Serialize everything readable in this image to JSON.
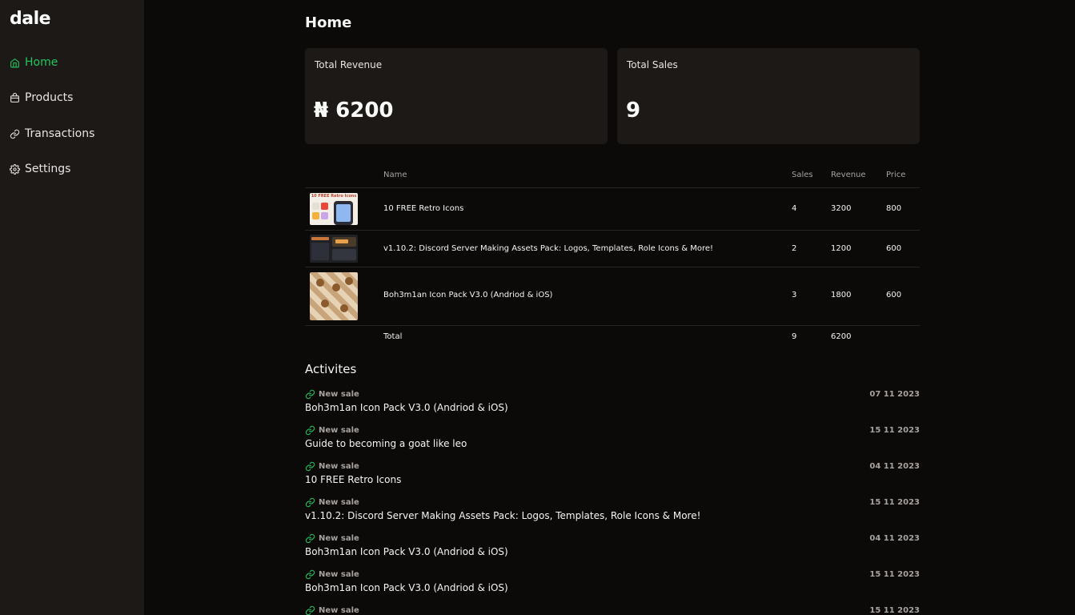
{
  "app": {
    "logo": "dale"
  },
  "sidebar": {
    "items": [
      {
        "label": "Home",
        "icon": "home-icon",
        "active": true
      },
      {
        "label": "Products",
        "icon": "bag-icon",
        "active": false
      },
      {
        "label": "Transactions",
        "icon": "link-icon",
        "active": false
      },
      {
        "label": "Settings",
        "icon": "gear-icon",
        "active": false
      }
    ]
  },
  "page": {
    "title": "Home"
  },
  "stats": {
    "revenue": {
      "label": "Total Revenue",
      "value": "₦ 6200"
    },
    "sales": {
      "label": "Total Sales",
      "value": "9"
    }
  },
  "table": {
    "headers": {
      "name": "Name",
      "sales": "Sales",
      "revenue": "Revenue",
      "price": "Price"
    },
    "rows": [
      {
        "name": "10 FREE Retro Icons",
        "sales": "4",
        "revenue": "3200",
        "price": "800",
        "thumb_text": "10 FREE Retro Icons"
      },
      {
        "name": "v1.10.2: Discord Server Making Assets Pack: Logos, Templates, Role Icons & More!",
        "sales": "2",
        "revenue": "1200",
        "price": "600"
      },
      {
        "name": "Boh3m1an Icon Pack V3.0 (Andriod & iOS)",
        "sales": "3",
        "revenue": "1800",
        "price": "600"
      }
    ],
    "total": {
      "label": "Total",
      "sales": "9",
      "revenue": "6200"
    }
  },
  "activities": {
    "title": "Activites",
    "items": [
      {
        "type": "New sale",
        "name": "Boh3m1an Icon Pack V3.0 (Andriod & iOS)",
        "date": "07 11 2023"
      },
      {
        "type": "New sale",
        "name": "Guide to becoming a goat like leo",
        "date": "15 11 2023"
      },
      {
        "type": "New sale",
        "name": "10 FREE Retro Icons",
        "date": "04 11 2023"
      },
      {
        "type": "New sale",
        "name": "v1.10.2: Discord Server Making Assets Pack: Logos, Templates, Role Icons & More!",
        "date": "15 11 2023"
      },
      {
        "type": "New sale",
        "name": "Boh3m1an Icon Pack V3.0 (Andriod & iOS)",
        "date": "04 11 2023"
      },
      {
        "type": "New sale",
        "name": "Boh3m1an Icon Pack V3.0 (Andriod & iOS)",
        "date": "15 11 2023"
      },
      {
        "type": "New sale",
        "name": "",
        "date": "15 11 2023"
      }
    ]
  },
  "colors": {
    "accent": "#22c55e",
    "sidebar_bg": "#1c1917",
    "page_bg": "#0b0a09",
    "card_bg": "#1c1917"
  }
}
